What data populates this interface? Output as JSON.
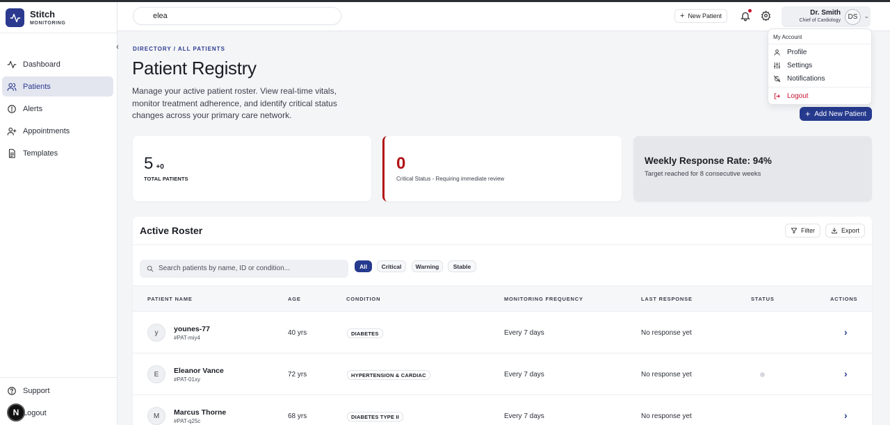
{
  "brand": {
    "name": "Stitch",
    "sub": "MONITORING"
  },
  "sidebar": {
    "items": [
      {
        "label": "Dashboard",
        "icon": "activity-icon"
      },
      {
        "label": "Patients",
        "icon": "users-icon",
        "active": true
      },
      {
        "label": "Alerts",
        "icon": "alert-circle-icon"
      },
      {
        "label": "Appointments",
        "icon": "user-plus-icon"
      },
      {
        "label": "Templates",
        "icon": "file-text-icon"
      }
    ],
    "support": "Support",
    "logout": "Logout",
    "badge": "N"
  },
  "topbar": {
    "search_value": "elea",
    "new_patient": "New Patient",
    "user_name": "Dr. Smith",
    "user_role": "Chief of Cardiology",
    "avatar_initials": "DS"
  },
  "dropdown": {
    "header": "My Account",
    "items": [
      "Profile",
      "Settings",
      "Notifications"
    ],
    "logout": "Logout"
  },
  "page": {
    "breadcrumb": "DIRECTORY / ALL PATIENTS",
    "title": "Patient Registry",
    "description": "Manage your active patient roster. View real-time vitals, monitor treatment adherence, and identify critical status changes across your primary care network.",
    "add_button": "Add New Patient"
  },
  "stats": {
    "total": "5",
    "total_delta": "+0",
    "total_label": "TOTAL PATIENTS",
    "critical": "0",
    "critical_label": "Critical Status - Requiring immediate review",
    "rate_title": "Weekly Response Rate: 94%",
    "rate_sub": "Target reached for 8 consecutive weeks"
  },
  "roster": {
    "title": "Active Roster",
    "filter": "Filter",
    "export": "Export",
    "search_placeholder": "Search patients by name, ID or condition...",
    "chips": [
      "All",
      "Critical",
      "Warning",
      "Stable"
    ],
    "columns": [
      "PATIENT NAME",
      "AGE",
      "CONDITION",
      "MONITORING FREQUENCY",
      "LAST RESPONSE",
      "STATUS",
      "ACTIONS"
    ],
    "rows": [
      {
        "initial": "y",
        "name": "younes-77",
        "id": "#PAT-miy4",
        "age": "40 yrs",
        "condition": "DIABETES",
        "frequency": "Every 7 days",
        "last": "No response yet"
      },
      {
        "initial": "E",
        "name": "Eleanor Vance",
        "id": "#PAT-01xy",
        "age": "72 yrs",
        "condition": "HYPERTENSION & CARDIAC",
        "frequency": "Every 7 days",
        "last": "No response yet"
      },
      {
        "initial": "M",
        "name": "Marcus Thorne",
        "id": "#PAT-q25c",
        "age": "68 yrs",
        "condition": "DIABETES TYPE II",
        "frequency": "Every 7 days",
        "last": "No response yet"
      }
    ]
  },
  "colors": {
    "accent": "#263a8e",
    "critical": "#b31217",
    "danger": "#c8102e"
  }
}
